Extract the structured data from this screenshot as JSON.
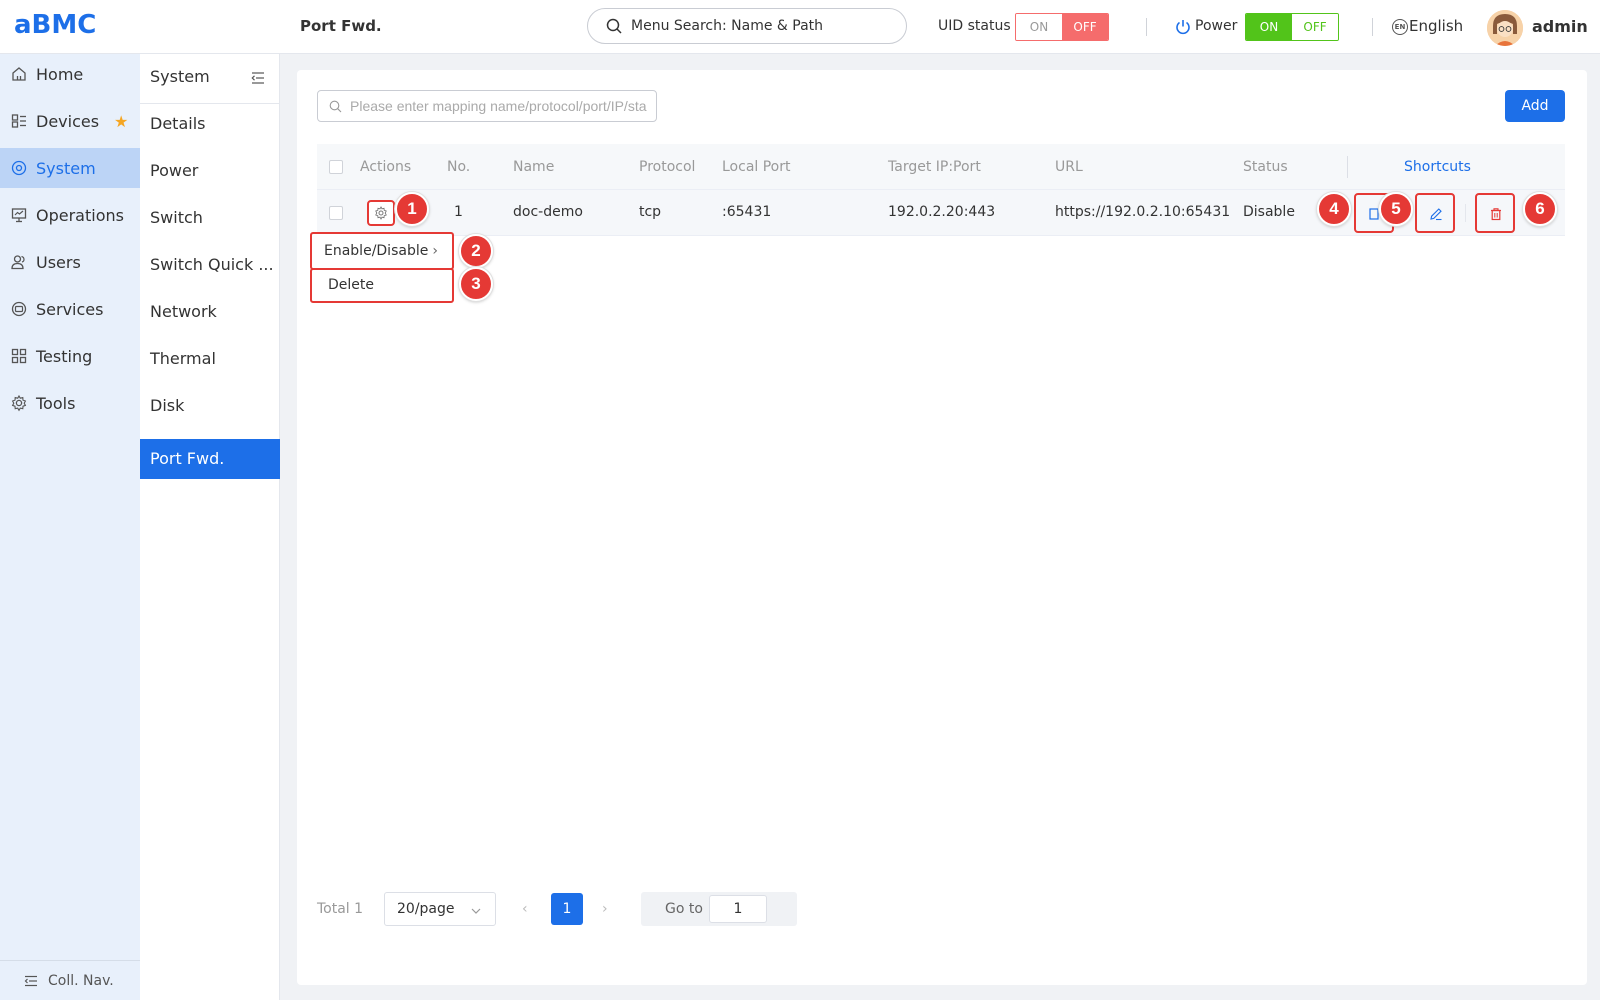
{
  "header": {
    "logo": "aBMC",
    "page_title": "Port Fwd.",
    "menu_search": "Menu Search: Name & Path",
    "uid_label": "UID status",
    "uid_on": "ON",
    "uid_off": "OFF",
    "power_label": "Power",
    "power_on": "ON",
    "power_off": "OFF",
    "language_icon": "EN",
    "language": "English",
    "user": "admin"
  },
  "main_nav": {
    "items": [
      {
        "label": "Home",
        "icon": "home-icon"
      },
      {
        "label": "Devices",
        "icon": "devices-icon"
      },
      {
        "label": "System",
        "icon": "system-icon"
      },
      {
        "label": "Operations",
        "icon": "operations-icon"
      },
      {
        "label": "Users",
        "icon": "users-icon"
      },
      {
        "label": "Services",
        "icon": "services-icon"
      },
      {
        "label": "Testing",
        "icon": "testing-icon"
      },
      {
        "label": "Tools",
        "icon": "tools-icon"
      }
    ],
    "active": "System",
    "collapse": "Coll. Nav."
  },
  "sub_nav": {
    "title": "System",
    "items": [
      "Details",
      "Power",
      "Switch",
      "Switch Quick ...",
      "Network",
      "Thermal",
      "Disk",
      "Port Fwd."
    ],
    "active": "Port Fwd."
  },
  "toolbar": {
    "search_placeholder": "Please enter mapping name/protocol/port/IP/sta",
    "add_label": "Add"
  },
  "table": {
    "columns": [
      "Actions",
      "No.",
      "Name",
      "Protocol",
      "Local Port",
      "Target IP:Port",
      "URL",
      "Status",
      "Shortcuts"
    ],
    "rows": [
      {
        "no": "1",
        "name": "doc-demo",
        "protocol": "tcp",
        "local_port": ":65431",
        "target": "192.0.2.20:443",
        "url": "https://192.0.2.10:65431",
        "status": "Disable"
      }
    ]
  },
  "actions_menu": {
    "enable_disable": "Enable/Disable",
    "delete": "Delete"
  },
  "markers": [
    "1",
    "2",
    "3",
    "4",
    "5",
    "6"
  ],
  "pagination": {
    "total": "Total 1",
    "page_size": "20/page",
    "current_page": "1",
    "goto_label": "Go to",
    "goto_value": "1"
  },
  "colors": {
    "accent": "#1d6fe8",
    "annotation": "#e53935",
    "power_on": "#52c41a",
    "uid_off": "#f56c6c"
  }
}
